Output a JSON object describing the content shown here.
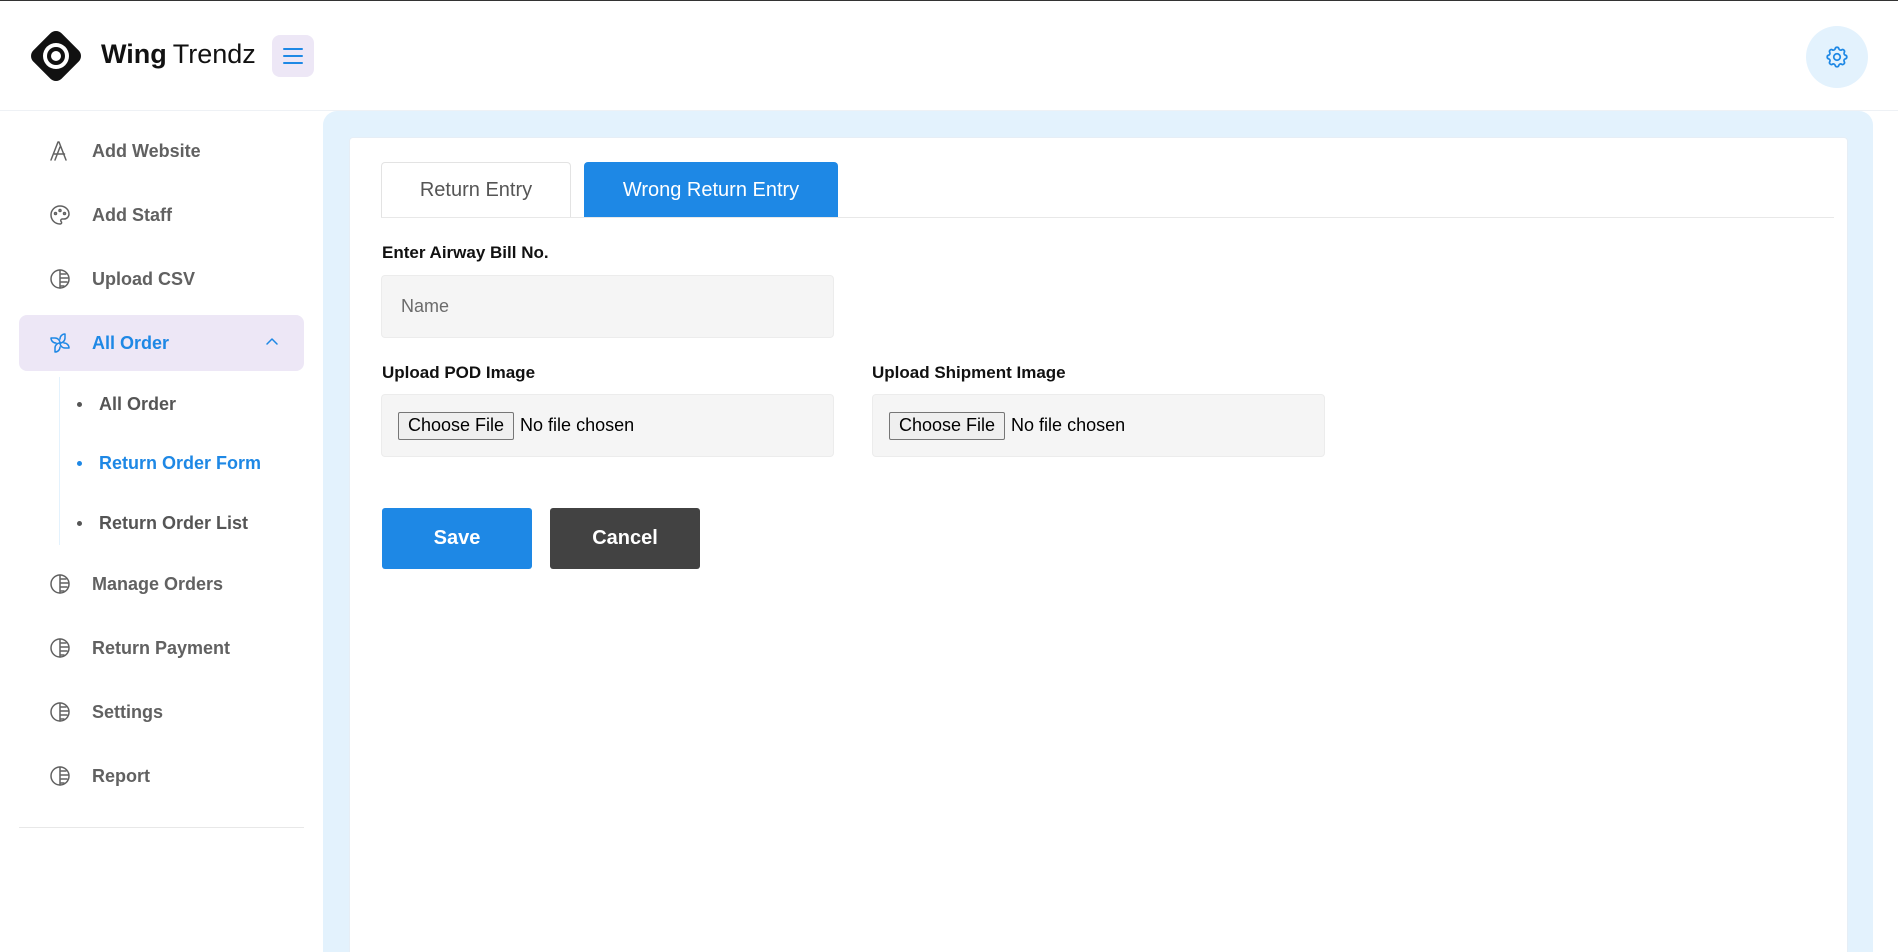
{
  "brand": {
    "name_bold": "Wing",
    "name_light": "Trendz"
  },
  "sidebar": {
    "items": [
      {
        "label": "Add Website",
        "icon": "letter-a-icon"
      },
      {
        "label": "Add Staff",
        "icon": "palette-icon"
      },
      {
        "label": "Upload CSV",
        "icon": "shadow-circle-icon"
      },
      {
        "label": "All Order",
        "icon": "windmill-icon",
        "expanded": true,
        "active": true
      },
      {
        "label": "Manage Orders",
        "icon": "shadow-circle-icon"
      },
      {
        "label": "Return Payment",
        "icon": "shadow-circle-icon"
      },
      {
        "label": "Settings",
        "icon": "shadow-circle-icon"
      },
      {
        "label": "Report",
        "icon": "shadow-circle-icon"
      }
    ],
    "sub_items": [
      {
        "label": "All Order"
      },
      {
        "label": "Return Order Form",
        "active": true
      },
      {
        "label": "Return Order List"
      }
    ]
  },
  "tabs": [
    {
      "label": "Return Entry"
    },
    {
      "label": "Wrong Return Entry",
      "active": true
    }
  ],
  "form": {
    "awb_label": "Enter Airway Bill No.",
    "awb_placeholder": "Name",
    "pod_label": "Upload POD Image",
    "shipment_label": "Upload Shipment Image",
    "choose_file": "Choose File",
    "no_file": "No file chosen",
    "save": "Save",
    "cancel": "Cancel"
  },
  "colors": {
    "accent": "#1e88e5",
    "active_bg": "#ede7f6",
    "main_bg": "#e3f2fd",
    "cancel_bg": "#424242"
  }
}
